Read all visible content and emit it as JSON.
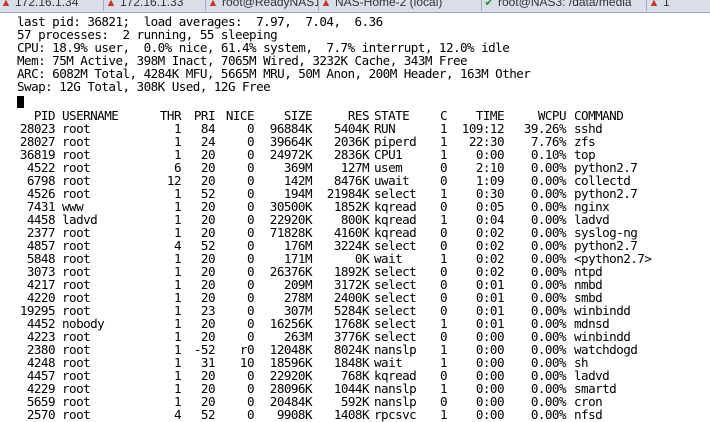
{
  "tabs": [
    {
      "label": "172.16.1.34",
      "icon": "warning-icon",
      "color": "#c0392b"
    },
    {
      "label": "172.16.1.33",
      "icon": "warning-icon",
      "color": "#c0392b"
    },
    {
      "label": "root@ReadyNAS1: ~",
      "icon": "warning-icon",
      "color": "#c0392b"
    },
    {
      "label": "NAS-Home-2 (local)",
      "icon": "warning-icon",
      "color": "#c0392b"
    },
    {
      "label": "root@NAS3: /data/media",
      "icon": "check-icon",
      "color": "#2e8b3a"
    },
    {
      "label": "1",
      "icon": "warning-icon",
      "color": "#c0392b"
    }
  ],
  "summary": [
    "last pid: 36821;  load averages:  7.97,  7.04,  6.36",
    "57 processes:  2 running, 55 sleeping",
    "CPU: 18.9% user,  0.0% nice, 61.4% system,  7.7% interrupt, 12.0% idle",
    "Mem: 75M Active, 398M Inact, 7065M Wired, 3232K Cache, 343M Free",
    "ARC: 6082M Total, 4284K MFU, 5665M MRU, 50M Anon, 200M Header, 163M Other",
    "Swap: 12G Total, 308K Used, 12G Free"
  ],
  "columns": [
    "PID",
    "USERNAME",
    "THR",
    "PRI",
    "NICE",
    "SIZE",
    "RES",
    "STATE",
    "C",
    "TIME",
    "WCPU",
    "COMMAND"
  ],
  "rows": [
    [
      "28023",
      "root",
      "1",
      "84",
      "0",
      "96884K",
      "5404K",
      "RUN",
      "1",
      "109:12",
      "39.26%",
      "sshd"
    ],
    [
      "28027",
      "root",
      "1",
      "24",
      "0",
      "39664K",
      "2036K",
      "piperd",
      "1",
      "22:30",
      "7.76%",
      "zfs"
    ],
    [
      "36819",
      "root",
      "1",
      "20",
      "0",
      "24972K",
      "2836K",
      "CPU1",
      "1",
      "0:00",
      "0.10%",
      "top"
    ],
    [
      "4522",
      "root",
      "6",
      "20",
      "0",
      "369M",
      "127M",
      "usem",
      "0",
      "2:10",
      "0.00%",
      "python2.7"
    ],
    [
      "6798",
      "root",
      "12",
      "20",
      "0",
      "142M",
      "8476K",
      "uwait",
      "0",
      "1:09",
      "0.00%",
      "collectd"
    ],
    [
      "4526",
      "root",
      "1",
      "52",
      "0",
      "194M",
      "21984K",
      "select",
      "1",
      "0:30",
      "0.00%",
      "python2.7"
    ],
    [
      "7431",
      "www",
      "1",
      "20",
      "0",
      "30500K",
      "1852K",
      "kqread",
      "0",
      "0:05",
      "0.00%",
      "nginx"
    ],
    [
      "4458",
      "ladvd",
      "1",
      "20",
      "0",
      "22920K",
      "800K",
      "kqread",
      "1",
      "0:04",
      "0.00%",
      "ladvd"
    ],
    [
      "2377",
      "root",
      "1",
      "20",
      "0",
      "71828K",
      "4160K",
      "kqread",
      "0",
      "0:02",
      "0.00%",
      "syslog-ng"
    ],
    [
      "4857",
      "root",
      "4",
      "52",
      "0",
      "176M",
      "3224K",
      "select",
      "0",
      "0:02",
      "0.00%",
      "python2.7"
    ],
    [
      "5848",
      "root",
      "1",
      "20",
      "0",
      "171M",
      "0K",
      "wait",
      "1",
      "0:02",
      "0.00%",
      "<python2.7>"
    ],
    [
      "3073",
      "root",
      "1",
      "20",
      "0",
      "26376K",
      "1892K",
      "select",
      "0",
      "0:02",
      "0.00%",
      "ntpd"
    ],
    [
      "4217",
      "root",
      "1",
      "20",
      "0",
      "209M",
      "3172K",
      "select",
      "0",
      "0:01",
      "0.00%",
      "nmbd"
    ],
    [
      "4220",
      "root",
      "1",
      "20",
      "0",
      "278M",
      "2400K",
      "select",
      "0",
      "0:01",
      "0.00%",
      "smbd"
    ],
    [
      "19295",
      "root",
      "1",
      "23",
      "0",
      "307M",
      "5284K",
      "select",
      "0",
      "0:01",
      "0.00%",
      "winbindd"
    ],
    [
      "4452",
      "nobody",
      "1",
      "20",
      "0",
      "16256K",
      "1768K",
      "select",
      "1",
      "0:01",
      "0.00%",
      "mdnsd"
    ],
    [
      "4223",
      "root",
      "1",
      "20",
      "0",
      "263M",
      "3776K",
      "select",
      "0",
      "0:00",
      "0.00%",
      "winbindd"
    ],
    [
      "2380",
      "root",
      "1",
      "-52",
      "r0",
      "12048K",
      "8024K",
      "nanslp",
      "1",
      "0:00",
      "0.00%",
      "watchdogd"
    ],
    [
      "4248",
      "root",
      "1",
      "31",
      "10",
      "18596K",
      "1848K",
      "wait",
      "1",
      "0:00",
      "0.00%",
      "sh"
    ],
    [
      "4457",
      "root",
      "1",
      "20",
      "0",
      "22920K",
      "768K",
      "kqread",
      "0",
      "0:00",
      "0.00%",
      "ladvd"
    ],
    [
      "4229",
      "root",
      "1",
      "20",
      "0",
      "28096K",
      "1044K",
      "nanslp",
      "1",
      "0:00",
      "0.00%",
      "smartd"
    ],
    [
      "5659",
      "root",
      "1",
      "20",
      "0",
      "20484K",
      "592K",
      "nanslp",
      "0",
      "0:00",
      "0.00%",
      "cron"
    ],
    [
      "2570",
      "root",
      "4",
      "52",
      "0",
      "9908K",
      "1408K",
      "rpcsvc",
      "1",
      "0:00",
      "0.00%",
      "nfsd"
    ]
  ]
}
